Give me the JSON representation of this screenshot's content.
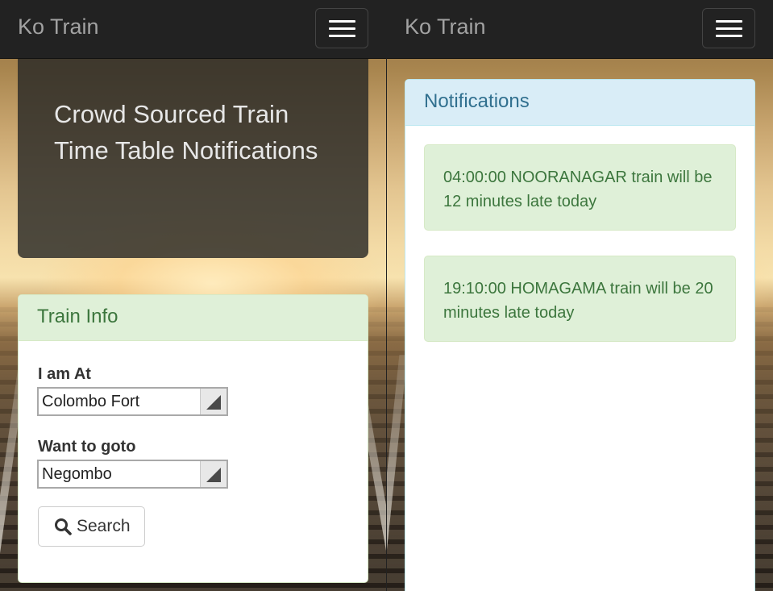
{
  "brand": "Ko Train",
  "menu_icon": "hamburger-menu-icon",
  "jumbotron": {
    "title": "Crowd Sourced Train Time Table Notifications"
  },
  "train_info": {
    "heading": "Train Info",
    "from_label": "I am At",
    "from_value": "Colombo Fort",
    "to_label": "Want to goto",
    "to_value": "Negombo",
    "search_label": "Search",
    "search_icon": "search-icon"
  },
  "notifications": {
    "heading": "Notifications",
    "items": [
      "04:00:00 NOORANAGAR train will be 12 minutes late today",
      "19:10:00 HOMAGAMA train will be 20 minutes late today"
    ]
  },
  "colors": {
    "navbar": "#222222",
    "success_bg": "#dff0d8",
    "success_text": "#3c763d",
    "info_bg": "#d9edf7",
    "info_text": "#31708f"
  }
}
